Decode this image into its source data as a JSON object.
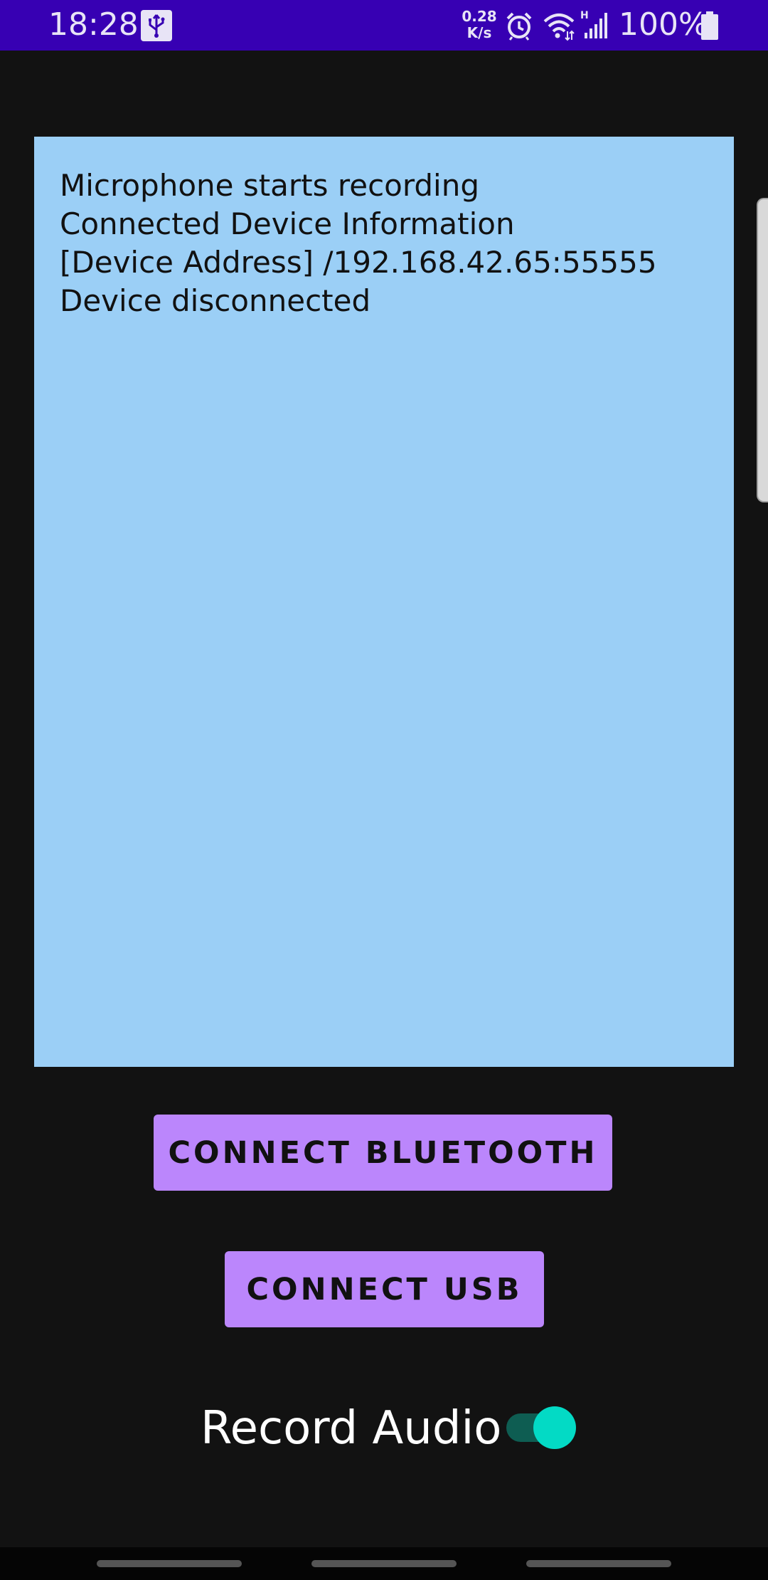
{
  "status_bar": {
    "time": "18:28",
    "net_speed_value": "0.28",
    "net_speed_unit": "K/s",
    "network_type": "H",
    "battery_percent": "100%",
    "icons": [
      "usb-icon",
      "alarm-icon",
      "wifi-icon",
      "signal-icon",
      "battery-icon"
    ]
  },
  "log": {
    "lines": [
      "Microphone starts recording",
      "Connected Device Information",
      "[Device Address] /192.168.42.65:55555",
      "Device disconnected"
    ]
  },
  "buttons": {
    "bluetooth_label": "CONNECT BLUETOOTH",
    "usb_label": "CONNECT USB"
  },
  "record_audio": {
    "label": "Record Audio",
    "enabled": true
  },
  "colors": {
    "status_bar": "#3700b3",
    "background": "#121212",
    "log_panel": "#9bcff6",
    "button": "#bb86fc",
    "switch_thumb": "#03dac5",
    "switch_track": "#0e5d52"
  }
}
